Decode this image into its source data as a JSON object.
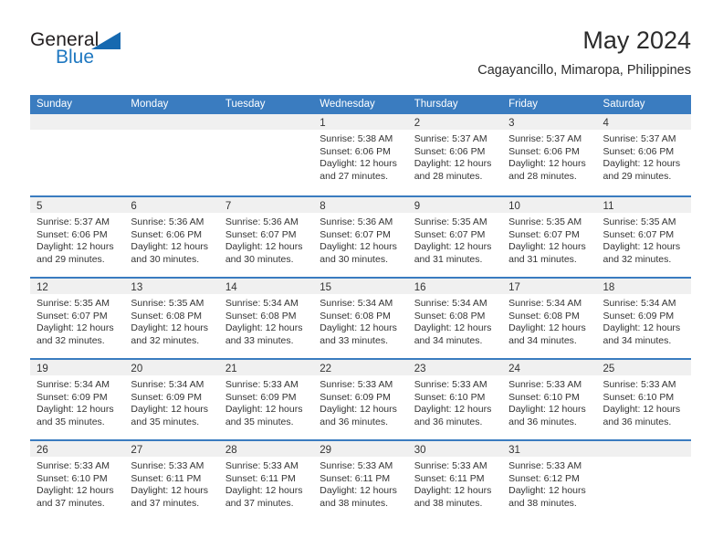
{
  "brand": {
    "name_part1": "General",
    "name_part2": "Blue",
    "accent_color": "#1669b0",
    "text_color": "#231f20"
  },
  "header": {
    "month_title": "May 2024",
    "location": "Cagayancillo, Mimaropa, Philippines",
    "header_bg_color": "#3a7cc0"
  },
  "weekdays": [
    "Sunday",
    "Monday",
    "Tuesday",
    "Wednesday",
    "Thursday",
    "Friday",
    "Saturday"
  ],
  "weeks": [
    [
      {
        "day": "",
        "empty": true
      },
      {
        "day": "",
        "empty": true
      },
      {
        "day": "",
        "empty": true
      },
      {
        "day": "1",
        "sunrise": "Sunrise: 5:38 AM",
        "sunset": "Sunset: 6:06 PM",
        "daylight_line1": "Daylight: 12 hours",
        "daylight_line2": "and 27 minutes."
      },
      {
        "day": "2",
        "sunrise": "Sunrise: 5:37 AM",
        "sunset": "Sunset: 6:06 PM",
        "daylight_line1": "Daylight: 12 hours",
        "daylight_line2": "and 28 minutes."
      },
      {
        "day": "3",
        "sunrise": "Sunrise: 5:37 AM",
        "sunset": "Sunset: 6:06 PM",
        "daylight_line1": "Daylight: 12 hours",
        "daylight_line2": "and 28 minutes."
      },
      {
        "day": "4",
        "sunrise": "Sunrise: 5:37 AM",
        "sunset": "Sunset: 6:06 PM",
        "daylight_line1": "Daylight: 12 hours",
        "daylight_line2": "and 29 minutes."
      }
    ],
    [
      {
        "day": "5",
        "sunrise": "Sunrise: 5:37 AM",
        "sunset": "Sunset: 6:06 PM",
        "daylight_line1": "Daylight: 12 hours",
        "daylight_line2": "and 29 minutes."
      },
      {
        "day": "6",
        "sunrise": "Sunrise: 5:36 AM",
        "sunset": "Sunset: 6:06 PM",
        "daylight_line1": "Daylight: 12 hours",
        "daylight_line2": "and 30 minutes."
      },
      {
        "day": "7",
        "sunrise": "Sunrise: 5:36 AM",
        "sunset": "Sunset: 6:07 PM",
        "daylight_line1": "Daylight: 12 hours",
        "daylight_line2": "and 30 minutes."
      },
      {
        "day": "8",
        "sunrise": "Sunrise: 5:36 AM",
        "sunset": "Sunset: 6:07 PM",
        "daylight_line1": "Daylight: 12 hours",
        "daylight_line2": "and 30 minutes."
      },
      {
        "day": "9",
        "sunrise": "Sunrise: 5:35 AM",
        "sunset": "Sunset: 6:07 PM",
        "daylight_line1": "Daylight: 12 hours",
        "daylight_line2": "and 31 minutes."
      },
      {
        "day": "10",
        "sunrise": "Sunrise: 5:35 AM",
        "sunset": "Sunset: 6:07 PM",
        "daylight_line1": "Daylight: 12 hours",
        "daylight_line2": "and 31 minutes."
      },
      {
        "day": "11",
        "sunrise": "Sunrise: 5:35 AM",
        "sunset": "Sunset: 6:07 PM",
        "daylight_line1": "Daylight: 12 hours",
        "daylight_line2": "and 32 minutes."
      }
    ],
    [
      {
        "day": "12",
        "sunrise": "Sunrise: 5:35 AM",
        "sunset": "Sunset: 6:07 PM",
        "daylight_line1": "Daylight: 12 hours",
        "daylight_line2": "and 32 minutes."
      },
      {
        "day": "13",
        "sunrise": "Sunrise: 5:35 AM",
        "sunset": "Sunset: 6:08 PM",
        "daylight_line1": "Daylight: 12 hours",
        "daylight_line2": "and 32 minutes."
      },
      {
        "day": "14",
        "sunrise": "Sunrise: 5:34 AM",
        "sunset": "Sunset: 6:08 PM",
        "daylight_line1": "Daylight: 12 hours",
        "daylight_line2": "and 33 minutes."
      },
      {
        "day": "15",
        "sunrise": "Sunrise: 5:34 AM",
        "sunset": "Sunset: 6:08 PM",
        "daylight_line1": "Daylight: 12 hours",
        "daylight_line2": "and 33 minutes."
      },
      {
        "day": "16",
        "sunrise": "Sunrise: 5:34 AM",
        "sunset": "Sunset: 6:08 PM",
        "daylight_line1": "Daylight: 12 hours",
        "daylight_line2": "and 34 minutes."
      },
      {
        "day": "17",
        "sunrise": "Sunrise: 5:34 AM",
        "sunset": "Sunset: 6:08 PM",
        "daylight_line1": "Daylight: 12 hours",
        "daylight_line2": "and 34 minutes."
      },
      {
        "day": "18",
        "sunrise": "Sunrise: 5:34 AM",
        "sunset": "Sunset: 6:09 PM",
        "daylight_line1": "Daylight: 12 hours",
        "daylight_line2": "and 34 minutes."
      }
    ],
    [
      {
        "day": "19",
        "sunrise": "Sunrise: 5:34 AM",
        "sunset": "Sunset: 6:09 PM",
        "daylight_line1": "Daylight: 12 hours",
        "daylight_line2": "and 35 minutes."
      },
      {
        "day": "20",
        "sunrise": "Sunrise: 5:34 AM",
        "sunset": "Sunset: 6:09 PM",
        "daylight_line1": "Daylight: 12 hours",
        "daylight_line2": "and 35 minutes."
      },
      {
        "day": "21",
        "sunrise": "Sunrise: 5:33 AM",
        "sunset": "Sunset: 6:09 PM",
        "daylight_line1": "Daylight: 12 hours",
        "daylight_line2": "and 35 minutes."
      },
      {
        "day": "22",
        "sunrise": "Sunrise: 5:33 AM",
        "sunset": "Sunset: 6:09 PM",
        "daylight_line1": "Daylight: 12 hours",
        "daylight_line2": "and 36 minutes."
      },
      {
        "day": "23",
        "sunrise": "Sunrise: 5:33 AM",
        "sunset": "Sunset: 6:10 PM",
        "daylight_line1": "Daylight: 12 hours",
        "daylight_line2": "and 36 minutes."
      },
      {
        "day": "24",
        "sunrise": "Sunrise: 5:33 AM",
        "sunset": "Sunset: 6:10 PM",
        "daylight_line1": "Daylight: 12 hours",
        "daylight_line2": "and 36 minutes."
      },
      {
        "day": "25",
        "sunrise": "Sunrise: 5:33 AM",
        "sunset": "Sunset: 6:10 PM",
        "daylight_line1": "Daylight: 12 hours",
        "daylight_line2": "and 36 minutes."
      }
    ],
    [
      {
        "day": "26",
        "sunrise": "Sunrise: 5:33 AM",
        "sunset": "Sunset: 6:10 PM",
        "daylight_line1": "Daylight: 12 hours",
        "daylight_line2": "and 37 minutes."
      },
      {
        "day": "27",
        "sunrise": "Sunrise: 5:33 AM",
        "sunset": "Sunset: 6:11 PM",
        "daylight_line1": "Daylight: 12 hours",
        "daylight_line2": "and 37 minutes."
      },
      {
        "day": "28",
        "sunrise": "Sunrise: 5:33 AM",
        "sunset": "Sunset: 6:11 PM",
        "daylight_line1": "Daylight: 12 hours",
        "daylight_line2": "and 37 minutes."
      },
      {
        "day": "29",
        "sunrise": "Sunrise: 5:33 AM",
        "sunset": "Sunset: 6:11 PM",
        "daylight_line1": "Daylight: 12 hours",
        "daylight_line2": "and 38 minutes."
      },
      {
        "day": "30",
        "sunrise": "Sunrise: 5:33 AM",
        "sunset": "Sunset: 6:11 PM",
        "daylight_line1": "Daylight: 12 hours",
        "daylight_line2": "and 38 minutes."
      },
      {
        "day": "31",
        "sunrise": "Sunrise: 5:33 AM",
        "sunset": "Sunset: 6:12 PM",
        "daylight_line1": "Daylight: 12 hours",
        "daylight_line2": "and 38 minutes."
      },
      {
        "day": "",
        "empty": true
      }
    ]
  ]
}
